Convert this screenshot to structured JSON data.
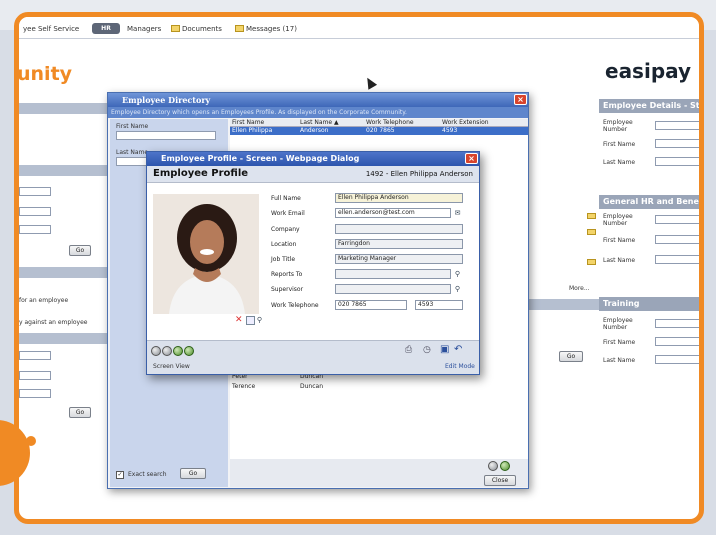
{
  "tabs": [
    {
      "label": "yee Self Service"
    },
    {
      "label": "HR"
    },
    {
      "label": "Managers"
    },
    {
      "label": "Documents"
    },
    {
      "label": "Messages (17)"
    }
  ],
  "brand": {
    "left": "unity",
    "right": "easipay"
  },
  "left_panel": {
    "go": "Go",
    "go2": "Go",
    "link1": "for an employee",
    "link2": "y against an employee"
  },
  "right_panel": {
    "section1": "Employee Details - Static",
    "section2": "General HR and Benefits",
    "section3": "Training",
    "employee_number": "Employee Number",
    "first_name": "First Name",
    "last_name": "Last Name",
    "more": "More...",
    "go": "Go"
  },
  "directory": {
    "title": "Employee Directory",
    "subtitle": "Employee Directory which opens an Employees Profile. As displayed on the Corporate Community.",
    "first_name_label": "First Name",
    "last_name_label": "Last Name",
    "exact_search": "Exact search",
    "go": "Go",
    "close": "Close",
    "columns": [
      "First Name",
      "Last Name ▲",
      "Work Telephone",
      "Work Extension"
    ],
    "selected_row": [
      "Ellen Philippa",
      "Anderson",
      "020 7865",
      "4593"
    ],
    "rows": [
      [
        "Peter",
        "Duncan"
      ],
      [
        "Terence",
        "Duncan"
      ]
    ]
  },
  "profile": {
    "title": "Employee Profile - Screen - Webpage Dialog",
    "heading": "Employee Profile",
    "id_name": "1492 - Ellen Philippa Anderson",
    "fields": {
      "full_name": {
        "label": "Full Name",
        "value": "Ellen Philippa Anderson"
      },
      "work_email": {
        "label": "Work Email",
        "value": "ellen.anderson@test.com"
      },
      "company": {
        "label": "Company",
        "value": ""
      },
      "location": {
        "label": "Location",
        "value": "Farringdon"
      },
      "job_title": {
        "label": "Job Title",
        "value": "Marketing Manager"
      },
      "reports_to": {
        "label": "Reports To",
        "value": ""
      },
      "supervisor": {
        "label": "Supervisor",
        "value": ""
      },
      "work_telephone": {
        "label": "Work Telephone",
        "value": "020 7865",
        "ext": "4593"
      }
    },
    "screen_view": "Screen View",
    "edit_mode": "Edit Mode"
  },
  "colors": {
    "accent": "#f08a24",
    "title_blue": "#3e67b8",
    "selection": "#3c6ec8"
  }
}
